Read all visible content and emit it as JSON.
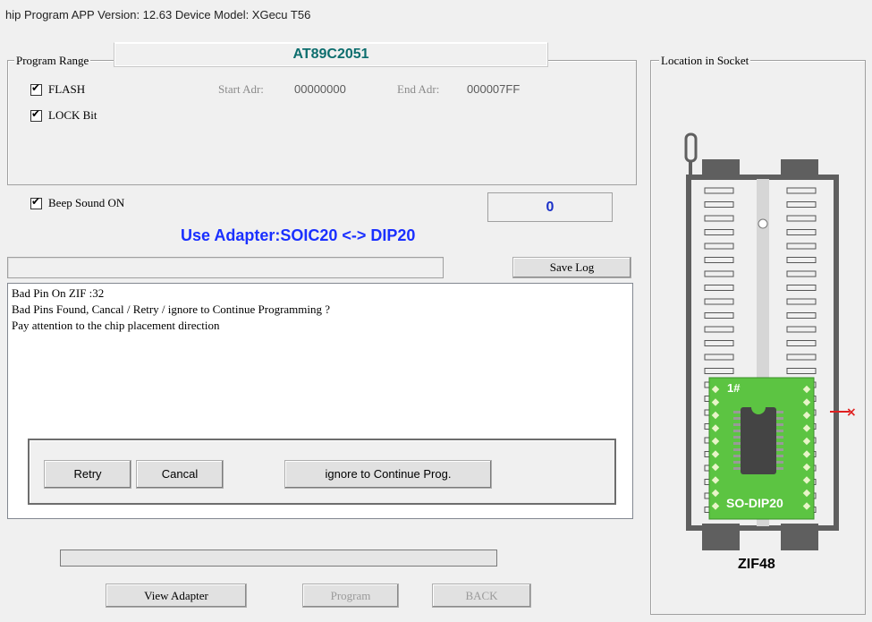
{
  "window": {
    "title": "hip Program    APP Version: 12.63 Device Model: XGecu T56"
  },
  "program_range": {
    "legend": "Program Range",
    "chip": "AT89C2051",
    "flash": {
      "label": "FLASH",
      "checked": true
    },
    "lock": {
      "label": "LOCK Bit",
      "checked": true
    },
    "start_label": "Start Adr:",
    "start_value": "00000000",
    "end_label": "End Adr:",
    "end_value": "000007FF"
  },
  "beep": {
    "label": "Beep Sound ON",
    "checked": true
  },
  "counter": "0",
  "adapter_text": "Use Adapter:SOIC20 <-> DIP20",
  "save_log": "Save Log",
  "log": [
    "Bad Pin On ZIF :32",
    "Bad Pins Found, Cancal / Retry / ignore to Continue Programming ?",
    "Pay attention to the chip placement direction"
  ],
  "dialog": {
    "retry": "Retry",
    "cancel": "Cancal",
    "ignore": "ignore to Continue Prog."
  },
  "progress": 0,
  "buttons": {
    "view_adapter": "View Adapter",
    "program": "Program",
    "back": "BACK"
  },
  "socket": {
    "legend": "Location in Socket",
    "adapter_top": "1#",
    "adapter_label": "SO-DIP20",
    "zif": "ZIF48",
    "colors": {
      "adapter": "#5cc442",
      "marker": "#e02020",
      "socket": "#5f5f5f"
    }
  }
}
